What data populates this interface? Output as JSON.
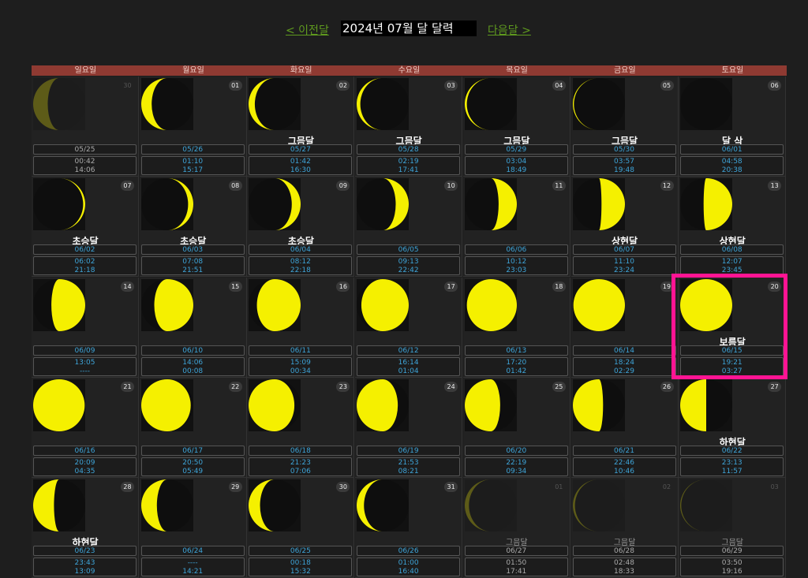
{
  "nav": {
    "prev": "< 이전달",
    "title": "2024년 07월 달 달력",
    "next": "다음달 >"
  },
  "weekdays": [
    "일요일",
    "월요일",
    "화요일",
    "수요일",
    "목요일",
    "금요일",
    "토요일"
  ],
  "colors": {
    "moon": "#f5f000",
    "dark": "#0e0e0e",
    "header": "#8f3a32",
    "info": "#3ea4d8",
    "highlight": "#ff1493"
  },
  "cells": [
    {
      "day": "30",
      "phase": "",
      "lunar": "05/25",
      "rise": "00:42",
      "set": "14:06",
      "illum": 0.28,
      "waxing": false,
      "dim": true
    },
    {
      "day": "01",
      "phase": "",
      "lunar": "05/26",
      "rise": "01:10",
      "set": "15:17",
      "illum": 0.2,
      "waxing": false,
      "dim": false
    },
    {
      "day": "02",
      "phase": "그믐달",
      "lunar": "05/27",
      "rise": "01:42",
      "set": "16:30",
      "illum": 0.12,
      "waxing": false,
      "dim": false
    },
    {
      "day": "03",
      "phase": "그믐달",
      "lunar": "05/28",
      "rise": "02:19",
      "set": "17:41",
      "illum": 0.07,
      "waxing": false,
      "dim": false
    },
    {
      "day": "04",
      "phase": "그믐달",
      "lunar": "05/29",
      "rise": "03:04",
      "set": "18:49",
      "illum": 0.04,
      "waxing": false,
      "dim": false
    },
    {
      "day": "05",
      "phase": "그믐달",
      "lunar": "05/30",
      "rise": "03:57",
      "set": "19:48",
      "illum": 0.02,
      "waxing": false,
      "dim": false
    },
    {
      "day": "06",
      "phase": "달 삭",
      "lunar": "06/01",
      "rise": "04:58",
      "set": "20:38",
      "illum": 0.0,
      "waxing": true,
      "dim": false
    },
    {
      "day": "07",
      "phase": "초승달",
      "lunar": "06/02",
      "rise": "06:02",
      "set": "21:18",
      "illum": 0.04,
      "waxing": true,
      "dim": false
    },
    {
      "day": "08",
      "phase": "초승달",
      "lunar": "06/03",
      "rise": "07:08",
      "set": "21:51",
      "illum": 0.1,
      "waxing": true,
      "dim": false
    },
    {
      "day": "09",
      "phase": "초승달",
      "lunar": "06/04",
      "rise": "08:12",
      "set": "22:18",
      "illum": 0.17,
      "waxing": true,
      "dim": false
    },
    {
      "day": "10",
      "phase": "",
      "lunar": "06/05",
      "rise": "09:13",
      "set": "22:42",
      "illum": 0.25,
      "waxing": true,
      "dim": false
    },
    {
      "day": "11",
      "phase": "",
      "lunar": "06/06",
      "rise": "10:12",
      "set": "23:03",
      "illum": 0.35,
      "waxing": true,
      "dim": false
    },
    {
      "day": "12",
      "phase": "상현달",
      "lunar": "06/07",
      "rise": "11:10",
      "set": "23:24",
      "illum": 0.45,
      "waxing": true,
      "dim": false
    },
    {
      "day": "13",
      "phase": "상현달",
      "lunar": "06/08",
      "rise": "12:07",
      "set": "23:45",
      "illum": 0.55,
      "waxing": true,
      "dim": false
    },
    {
      "day": "14",
      "phase": "",
      "lunar": "06/09",
      "rise": "13:05",
      "set": "----",
      "illum": 0.65,
      "waxing": true,
      "dim": false
    },
    {
      "day": "15",
      "phase": "",
      "lunar": "06/10",
      "rise": "14:06",
      "set": "00:08",
      "illum": 0.75,
      "waxing": true,
      "dim": false
    },
    {
      "day": "16",
      "phase": "",
      "lunar": "06/11",
      "rise": "15:09",
      "set": "00:34",
      "illum": 0.84,
      "waxing": true,
      "dim": false
    },
    {
      "day": "17",
      "phase": "",
      "lunar": "06/12",
      "rise": "16:14",
      "set": "01:04",
      "illum": 0.91,
      "waxing": true,
      "dim": false
    },
    {
      "day": "18",
      "phase": "",
      "lunar": "06/13",
      "rise": "17:20",
      "set": "01:42",
      "illum": 0.96,
      "waxing": true,
      "dim": false
    },
    {
      "day": "19",
      "phase": "",
      "lunar": "06/14",
      "rise": "18:24",
      "set": "02:29",
      "illum": 0.99,
      "waxing": true,
      "dim": false
    },
    {
      "day": "20",
      "phase": "보름달",
      "lunar": "06/15",
      "rise": "19:21",
      "set": "03:27",
      "illum": 1.0,
      "waxing": true,
      "dim": false
    },
    {
      "day": "21",
      "phase": "",
      "lunar": "06/16",
      "rise": "20:09",
      "set": "04:35",
      "illum": 0.99,
      "waxing": false,
      "dim": false
    },
    {
      "day": "22",
      "phase": "",
      "lunar": "06/17",
      "rise": "20:50",
      "set": "05:49",
      "illum": 0.95,
      "waxing": false,
      "dim": false
    },
    {
      "day": "23",
      "phase": "",
      "lunar": "06/18",
      "rise": "21:23",
      "set": "07:06",
      "illum": 0.88,
      "waxing": false,
      "dim": false
    },
    {
      "day": "24",
      "phase": "",
      "lunar": "06/19",
      "rise": "21:53",
      "set": "08:21",
      "illum": 0.79,
      "waxing": false,
      "dim": false
    },
    {
      "day": "25",
      "phase": "",
      "lunar": "06/20",
      "rise": "22:19",
      "set": "09:34",
      "illum": 0.68,
      "waxing": false,
      "dim": false
    },
    {
      "day": "26",
      "phase": "",
      "lunar": "06/21",
      "rise": "22:46",
      "set": "10:46",
      "illum": 0.58,
      "waxing": false,
      "dim": false
    },
    {
      "day": "27",
      "phase": "하현달",
      "lunar": "06/22",
      "rise": "23:13",
      "set": "11:57",
      "illum": 0.5,
      "waxing": false,
      "dim": false
    },
    {
      "day": "28",
      "phase": "하현달",
      "lunar": "06/23",
      "rise": "23:43",
      "set": "13:09",
      "illum": 0.4,
      "waxing": false,
      "dim": false
    },
    {
      "day": "29",
      "phase": "",
      "lunar": "06/24",
      "rise": "----",
      "set": "14:21",
      "illum": 0.3,
      "waxing": false,
      "dim": false
    },
    {
      "day": "30",
      "phase": "",
      "lunar": "06/25",
      "rise": "00:18",
      "set": "15:32",
      "illum": 0.22,
      "waxing": false,
      "dim": false
    },
    {
      "day": "31",
      "phase": "",
      "lunar": "06/26",
      "rise": "01:00",
      "set": "16:40",
      "illum": 0.14,
      "waxing": false,
      "dim": false
    },
    {
      "day": "01",
      "phase": "그믐달",
      "lunar": "06/27",
      "rise": "01:50",
      "set": "17:41",
      "illum": 0.08,
      "waxing": false,
      "dim": true
    },
    {
      "day": "02",
      "phase": "그믐달",
      "lunar": "06/28",
      "rise": "02:48",
      "set": "18:33",
      "illum": 0.04,
      "waxing": false,
      "dim": true
    },
    {
      "day": "03",
      "phase": "그믐달",
      "lunar": "06/29",
      "rise": "03:50",
      "set": "19:16",
      "illum": 0.02,
      "waxing": false,
      "dim": true
    }
  ]
}
